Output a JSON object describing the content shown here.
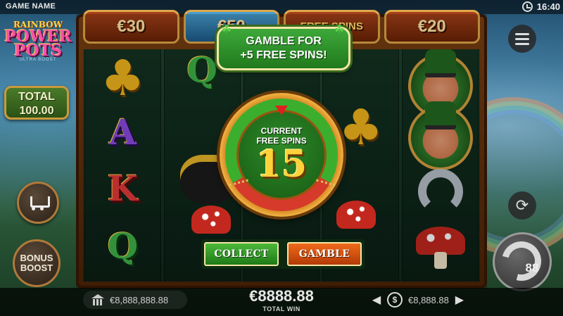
{
  "header": {
    "game_name": "GAME NAME",
    "time": "16:40"
  },
  "logo": {
    "line1": "RAINBOW",
    "line2": "POWER",
    "line3": "POTS",
    "sub": "ULTRA BOOST"
  },
  "total": {
    "label": "TOTAL",
    "value": "100.00"
  },
  "prizes": [
    {
      "label": "€30"
    },
    {
      "label": "€50"
    },
    {
      "label": "FREE SPINS"
    },
    {
      "label": "€20"
    }
  ],
  "reel_symbols": {
    "col1": [
      "clover",
      "A",
      "K",
      "Q"
    ],
    "col2": [
      "Q",
      "pot"
    ],
    "col3": [],
    "col4": [
      "clover"
    ],
    "col5": [
      "leprechaun",
      "leprechaun",
      "horseshoe",
      "mushroom"
    ]
  },
  "side_buttons": {
    "bonus_boost": "BONUS BOOST"
  },
  "spin": {
    "count": "88"
  },
  "gamble": {
    "banner_line1": "GAMBLE FOR",
    "banner_line2": "+5 FREE SPINS!",
    "wheel_label_line1": "CURRENT",
    "wheel_label_line2": "FREE SPINS",
    "current_free_spins": "15",
    "collect_label": "COLLECT",
    "gamble_label": "GAMBLE"
  },
  "bottom": {
    "balance": "€8,888,888.88",
    "total_win_amount": "€8888.88",
    "total_win_label": "TOTAL WIN",
    "bet": "€8,888.88"
  },
  "colors": {
    "wheel_green": "#3cae2e",
    "wheel_red": "#d63a2a",
    "collect_green": "#4cb83a",
    "gamble_orange": "#f06a1a",
    "gold": "#ffd23a"
  }
}
